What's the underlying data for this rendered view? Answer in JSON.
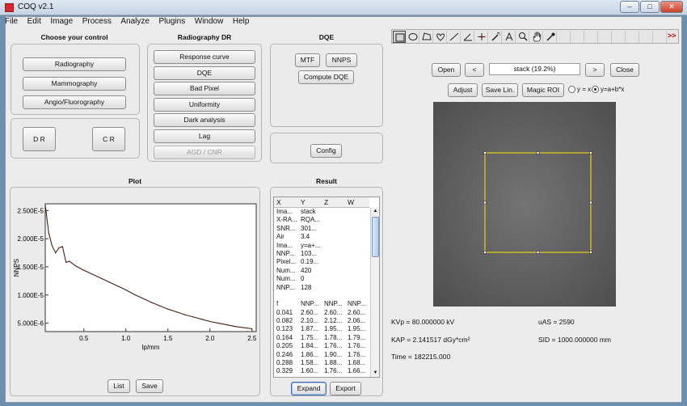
{
  "window": {
    "title": "COQ  v2.1",
    "controls": {
      "minimize": "–",
      "maximize": "□",
      "close": "✕"
    }
  },
  "menu": [
    "File",
    "Edit",
    "Image",
    "Process",
    "Analyze",
    "Plugins",
    "Window",
    "Help"
  ],
  "choose_control": {
    "title": "Choose your control",
    "buttons": [
      "Radiography",
      "Mammography",
      "Angio/Fluorography"
    ],
    "dr_label": "D R",
    "cr_label": "C R"
  },
  "radiography_dr": {
    "title": "Radiography DR",
    "buttons": [
      "Response curve",
      "DQE",
      "Bad Pixel",
      "Uniformity",
      "Dark analysis",
      "Lag",
      "AGD / CNR"
    ]
  },
  "dqe": {
    "title": "DQE",
    "mtf_label": "MTF",
    "nnps_label": "NNPS",
    "compute_label": "Compute DQE",
    "config_label": "Config"
  },
  "plot": {
    "title": "Plot",
    "list_label": "List",
    "save_label": "Save"
  },
  "chart_data": {
    "type": "line",
    "title": "",
    "xlabel": "lp/mm",
    "ylabel": "NNPS",
    "xlim": [
      0.041,
      2.55
    ],
    "ylim": [
      3.5e-06,
      2.62e-05
    ],
    "x_ticks": [
      0.5,
      1.0,
      1.5,
      2.0,
      2.5
    ],
    "x_tick_labels": [
      "0.5",
      "1.0",
      "1.5",
      "2.0",
      "2.5"
    ],
    "y_ticks": [
      5e-06,
      1e-05,
      1.5e-05,
      2e-05,
      2.5e-05
    ],
    "y_tick_labels": [
      "5.000E-6",
      "1.000E-5",
      "1.500E-5",
      "2.000E-5",
      "2.500E-5"
    ],
    "grid": false,
    "series": [
      {
        "color": "#4a1f14",
        "x": [
          0.041,
          0.082,
          0.123,
          0.164,
          0.205,
          0.246,
          0.288,
          0.329,
          0.4,
          0.5,
          0.6,
          0.7,
          0.8,
          0.9,
          1.0,
          1.1,
          1.2,
          1.3,
          1.4,
          1.5,
          1.6,
          1.7,
          1.8,
          1.9,
          2.0,
          2.1,
          2.2,
          2.3,
          2.4,
          2.5
        ],
        "y": [
          2.6e-05,
          2.1e-05,
          1.87e-05,
          1.75e-05,
          1.84e-05,
          1.86e-05,
          1.58e-05,
          1.6e-05,
          1.52e-05,
          1.44e-05,
          1.37e-05,
          1.3e-05,
          1.23e-05,
          1.16e-05,
          1.09e-05,
          1.01e-05,
          9.4e-06,
          8.7e-06,
          8.1e-06,
          7.5e-06,
          7e-06,
          6.5e-06,
          6.1e-06,
          5.7e-06,
          5.3e-06,
          5e-06,
          4.7e-06,
          4.4e-06,
          4.2e-06,
          4e-06
        ]
      }
    ]
  },
  "result": {
    "title": "Result",
    "headers": [
      "X",
      "Y",
      "Z",
      "W"
    ],
    "rows": [
      [
        "Ima...",
        "stack",
        "",
        ""
      ],
      [
        "X-RA...",
        "RQA...",
        "",
        ""
      ],
      [
        "SNR...",
        "301...",
        "",
        ""
      ],
      [
        "Air",
        "3.4",
        "",
        ""
      ],
      [
        "Ima...",
        "y=a+...",
        "",
        ""
      ],
      [
        "NNP...",
        "103...",
        "",
        ""
      ],
      [
        "Pixel...",
        "0.19...",
        "",
        ""
      ],
      [
        "Num...",
        "420",
        "",
        ""
      ],
      [
        "Num...",
        "0",
        "",
        ""
      ],
      [
        "NNP...",
        "128",
        "",
        ""
      ],
      [
        "",
        "",
        "",
        ""
      ],
      [
        "f",
        "NNP...",
        "NNP...",
        "NNP..."
      ],
      [
        "0.041",
        "2.60...",
        "2.60...",
        "2.60..."
      ],
      [
        "0.082",
        "2.10...",
        "2.12...",
        "2.06..."
      ],
      [
        "0.123",
        "1.87...",
        "1.95...",
        "1.95..."
      ],
      [
        "0.164",
        "1.75...",
        "1.78...",
        "1.79..."
      ],
      [
        "0.205",
        "1.84...",
        "1.76...",
        "1.76..."
      ],
      [
        "0.246",
        "1.86...",
        "1.90...",
        "1.76..."
      ],
      [
        "0.288",
        "1.58...",
        "1.88...",
        "1.68..."
      ],
      [
        "0.329",
        "1.60...",
        "1.76...",
        "1.66..."
      ]
    ],
    "expand_label": "Expand",
    "export_label": "Export"
  },
  "viewer": {
    "open_label": "Open",
    "prev_label": "<",
    "stack_label": "stack (19.2%)",
    "next_label": ">",
    "close_label": "Close",
    "adjust_label": "Adjust",
    "save_lin_label": "Save Lin.",
    "magic_roi_label": "Magic ROI",
    "radio_linear": "y = x",
    "radio_model": "y=a+b*x",
    "roi_color": "#e3d21a"
  },
  "info": {
    "kvp": "KVp = 80.000000 kV",
    "uas": "uAS = 2590",
    "kap": "KAP = 2.141517 dGy*cm²",
    "sid": "SID = 1000.000000 mm",
    "time": "Time = 182215.000"
  },
  "tools": [
    "rectangle-tool",
    "oval-tool",
    "polygon-tool",
    "freehand-tool",
    "line-tool",
    "angle-tool",
    "point-tool",
    "wand-tool",
    "text-tool",
    "zoom-tool",
    "hand-tool",
    "dropper-tool"
  ],
  "toolbar_more": ">>"
}
